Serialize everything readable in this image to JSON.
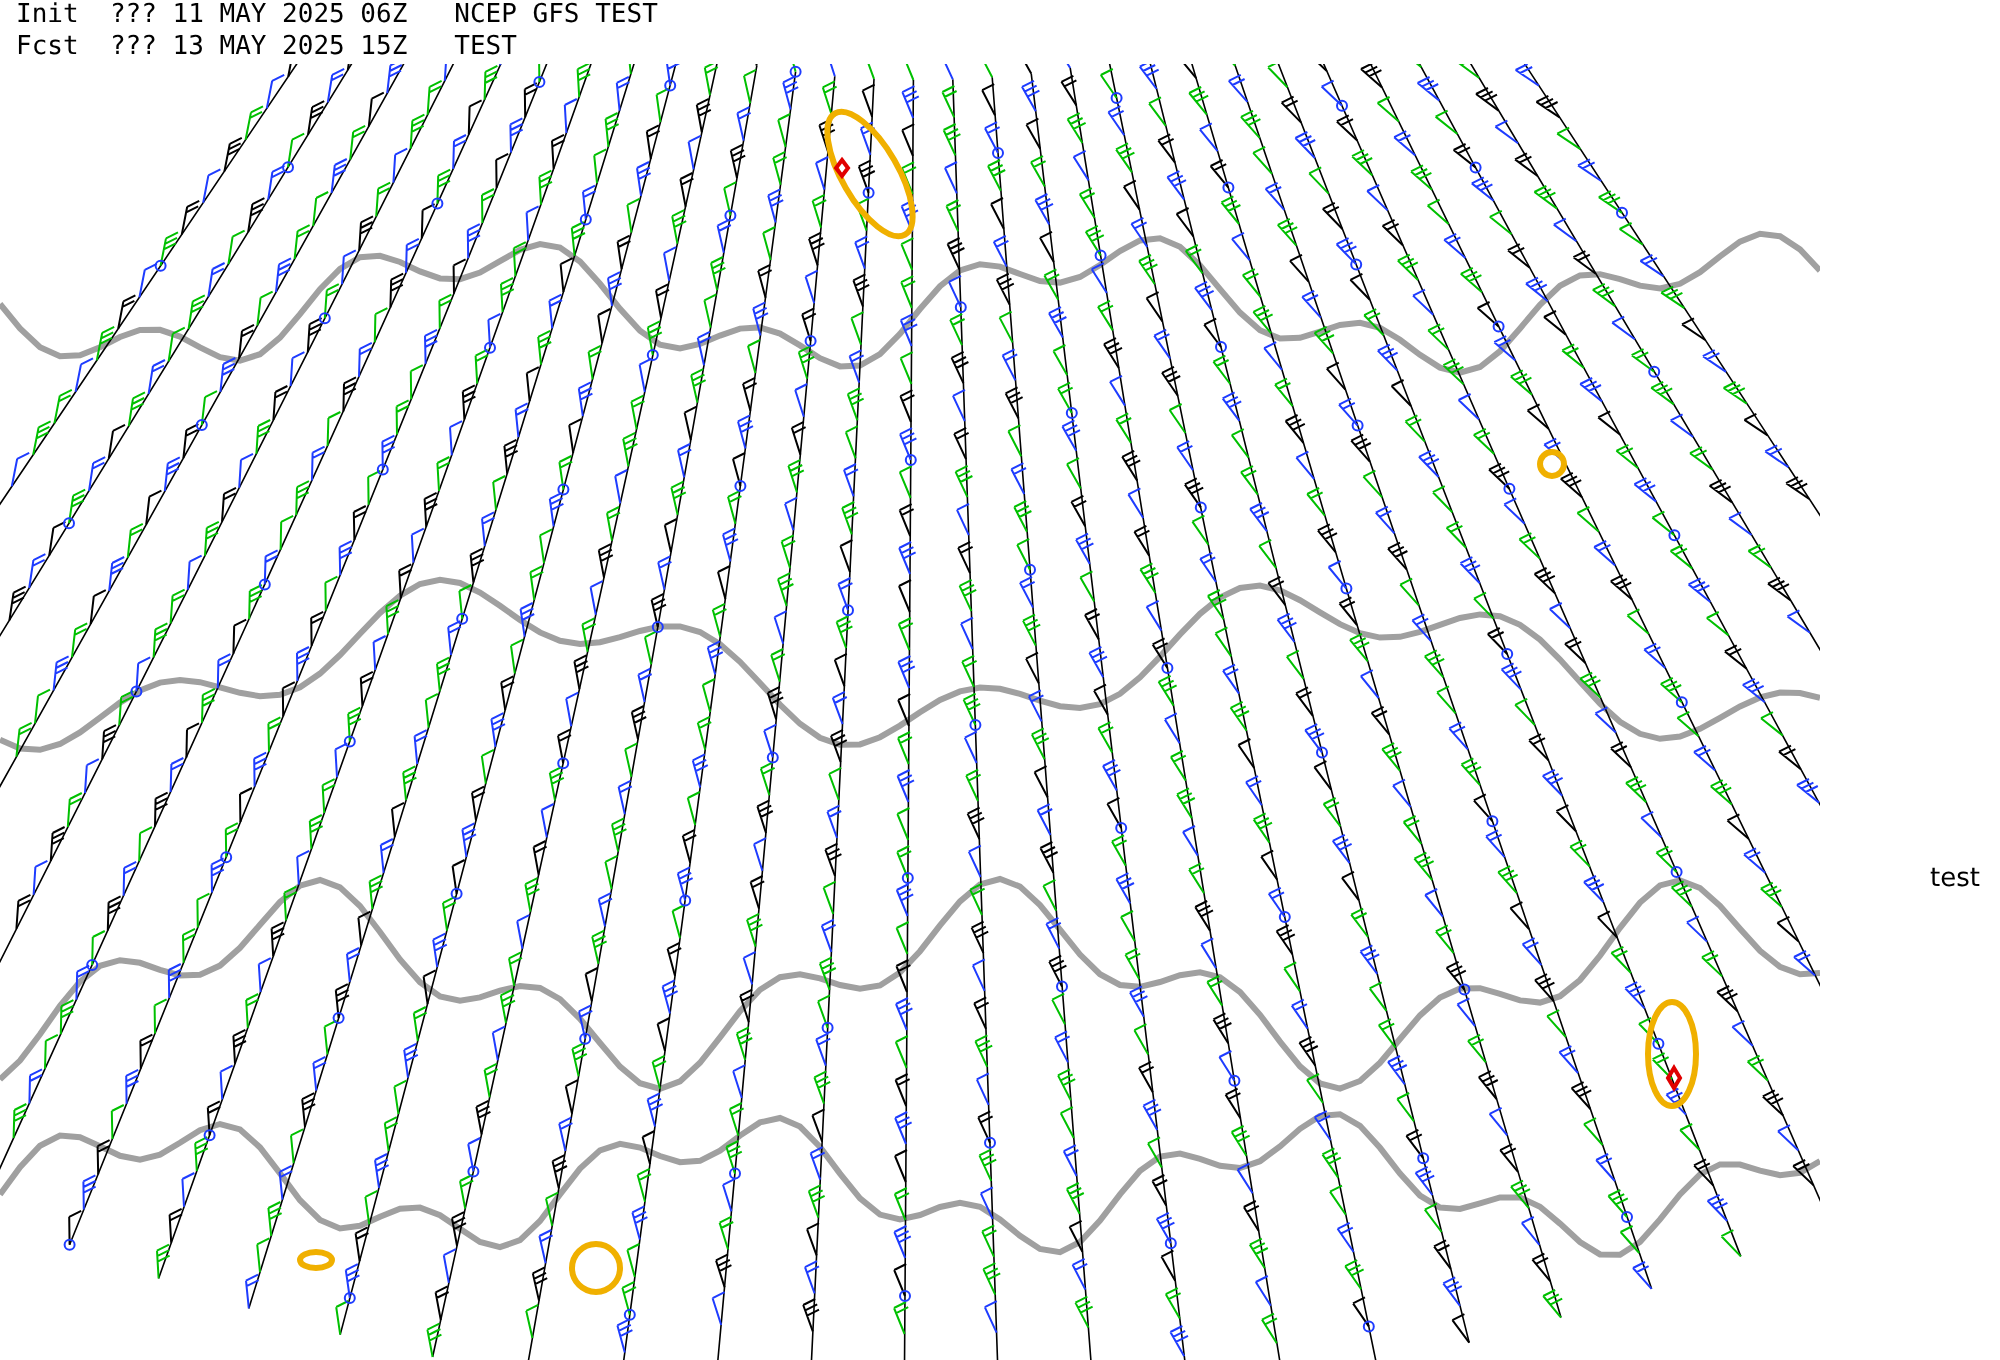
{
  "header": {
    "lines": [
      "Init  ??? 11 MAY 2025 06Z   NCEP GFS TEST",
      "Fcst  ??? 13 MAY 2025 15Z   TEST"
    ]
  },
  "side_label": "test"
}
